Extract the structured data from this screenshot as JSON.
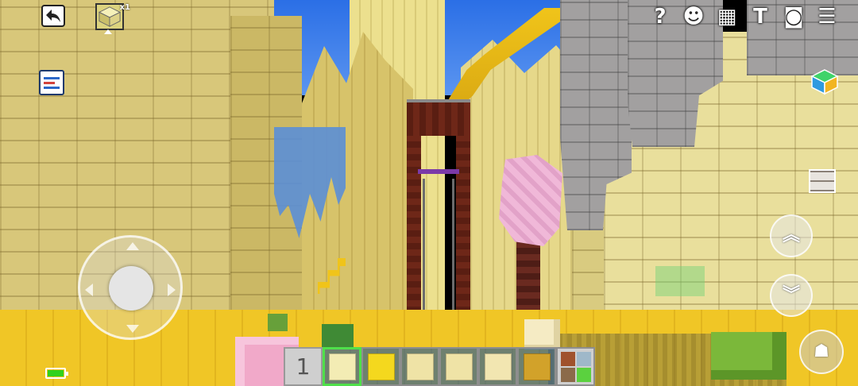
{
  "hud": {
    "selected_block_badge": "x1",
    "hotbar": {
      "count_label": "1",
      "slots": [
        {
          "icon": "sandstone-block-icon",
          "color": "#f3ecb4",
          "active": true
        },
        {
          "icon": "gold-block-icon",
          "color": "#f4d81e",
          "active": false
        },
        {
          "icon": "chiseled-sandstone-icon",
          "color": "#efe3a6",
          "active": false
        },
        {
          "icon": "sandstone-brick-icon",
          "color": "#efe3a6",
          "active": false
        },
        {
          "icon": "smooth-sandstone-icon",
          "color": "#f2e6b1",
          "active": false
        },
        {
          "icon": "lantern-block-icon",
          "color": "#d2a22a",
          "active": false
        }
      ],
      "more_icon": "inventory-grid-icon"
    },
    "top_icons": [
      {
        "name": "help-icon",
        "glyph": "?"
      },
      {
        "name": "friends-icon",
        "glyph": "☻"
      },
      {
        "name": "grid-icon",
        "glyph": "▦"
      },
      {
        "name": "text-tool-icon",
        "glyph": "T"
      },
      {
        "name": "camera-icon",
        "glyph": "◙"
      },
      {
        "name": "settings-list-icon",
        "glyph": "☰"
      }
    ],
    "fly_up_glyph": "︽",
    "fly_down_glyph": "︾",
    "jump_glyph": "☗",
    "battery_level": 1.0,
    "accent_color": "#4fe04a"
  }
}
